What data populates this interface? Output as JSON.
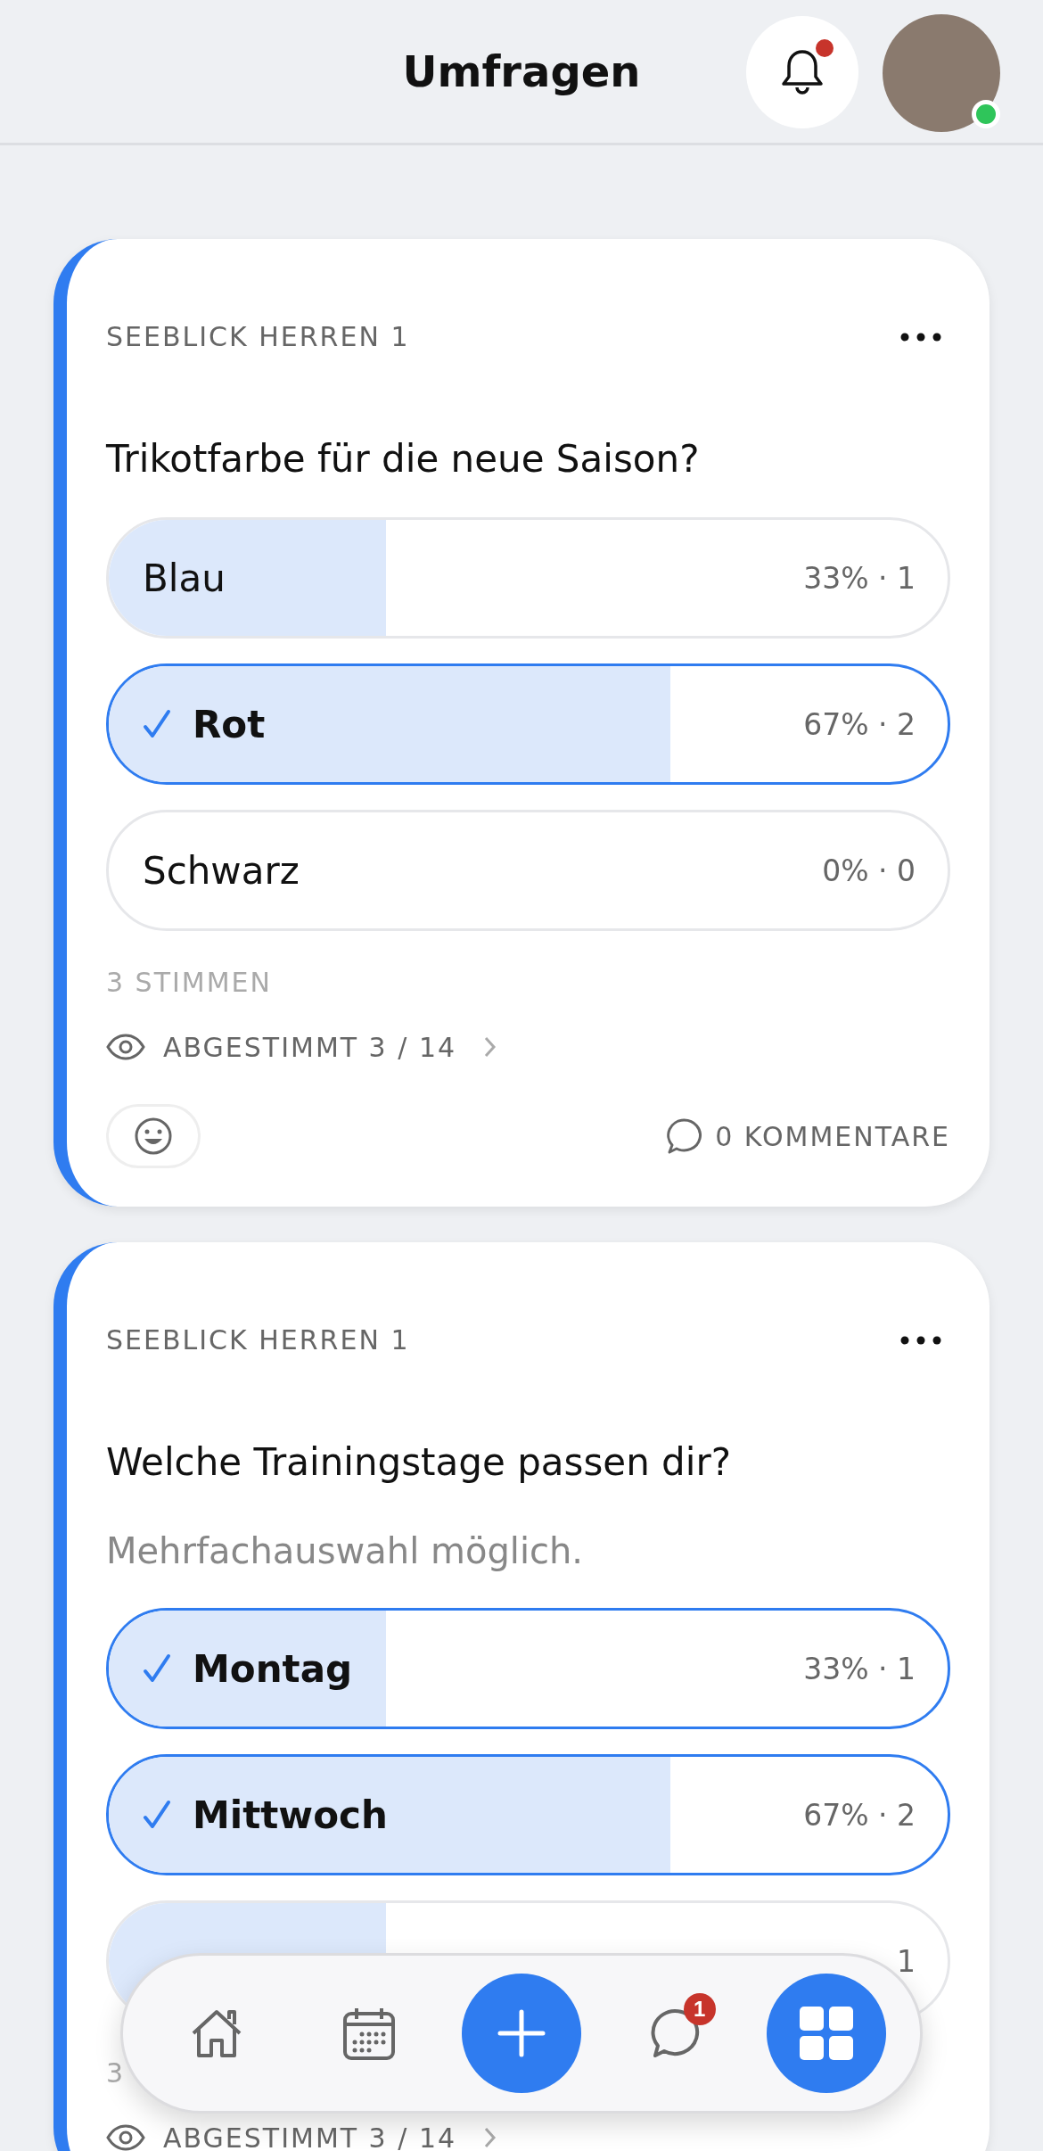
{
  "header": {
    "title": "Umfragen",
    "notification_unread": true,
    "avatar_online": true
  },
  "polls": [
    {
      "group": "SEEBLICK HERREN 1",
      "question": "Trikotfarbe für die neue Saison?",
      "options": [
        {
          "label": "Blau",
          "reading": "33% · 1",
          "level": 0.33,
          "selected": false
        },
        {
          "label": "Rot",
          "reading": "67% · 2",
          "level": 0.67,
          "selected": true
        },
        {
          "label": "Schwarz",
          "reading": "0% · 0",
          "selected": false
        }
      ],
      "votes": "3 STIMMEN",
      "voted": "ABGESTIMMT 3 / 14",
      "comments": "0 KOMMENTARE"
    },
    {
      "group": "SEEBLICK HERREN 1",
      "question": "Welche Trainingstage passen dir?",
      "hint": "Mehrfachauswahl möglich.",
      "options": [
        {
          "label": "Montag",
          "reading": "33% · 1",
          "level": 0.33,
          "selected": true
        },
        {
          "label": "Mittwoch",
          "reading": "67% · 2",
          "level": 0.67,
          "selected": true
        },
        {
          "reading": "1",
          "level": 0.33,
          "selected": false
        }
      ],
      "votes": "3",
      "voted": "ABGESTIMMT 3 / 14"
    }
  ],
  "nav": {
    "items": [
      {
        "kind": "home"
      },
      {
        "kind": "calendar"
      },
      {
        "kind": "add"
      },
      {
        "kind": "chat",
        "badge": "1"
      },
      {
        "kind": "grid",
        "selected": true
      }
    ]
  }
}
